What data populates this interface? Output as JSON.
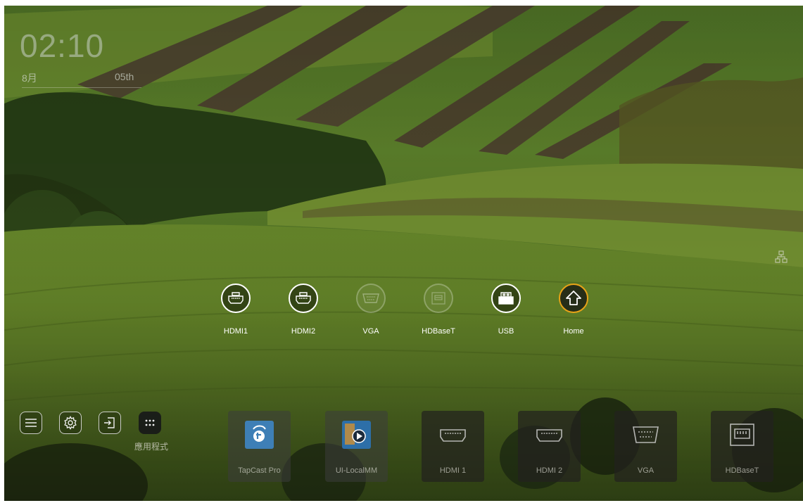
{
  "clock": {
    "time": "02:10",
    "month": "8月",
    "day": "05th"
  },
  "sources": [
    {
      "id": "hdmi1",
      "label": "HDMI1",
      "icon": "hdmi-icon",
      "active": true
    },
    {
      "id": "hdmi2",
      "label": "HDMI2",
      "icon": "hdmi-icon",
      "active": true
    },
    {
      "id": "vga",
      "label": "VGA",
      "icon": "vga-icon",
      "active": false
    },
    {
      "id": "hdbaset",
      "label": "HDBaseT",
      "icon": "hdbaset-icon",
      "active": false
    },
    {
      "id": "usb",
      "label": "USB",
      "icon": "usb-icon",
      "active": true
    },
    {
      "id": "home",
      "label": "Home",
      "icon": "home-icon",
      "active": true,
      "accent": "#e8a317"
    }
  ],
  "toolbar": {
    "menu_icon": "menu-icon",
    "settings_icon": "gear-icon",
    "input_icon": "input-source-icon",
    "apps_icon": "apps-grid-icon",
    "apps_label": "應用程式"
  },
  "tiles": [
    {
      "label": "TapCast Pro",
      "icon": "tapcast-app-icon"
    },
    {
      "label": "UI-LocalMM",
      "icon": "local-media-app-icon"
    },
    {
      "label": "HDMI 1",
      "icon": "hdmi-icon"
    },
    {
      "label": "HDMI 2",
      "icon": "hdmi-icon"
    },
    {
      "label": "VGA",
      "icon": "vga-icon"
    },
    {
      "label": "HDBaseT",
      "icon": "hdbaset-icon"
    }
  ],
  "status": {
    "network_icon": "network-icon"
  },
  "colors": {
    "accent": "#e8a317",
    "text": "#ffffff"
  }
}
